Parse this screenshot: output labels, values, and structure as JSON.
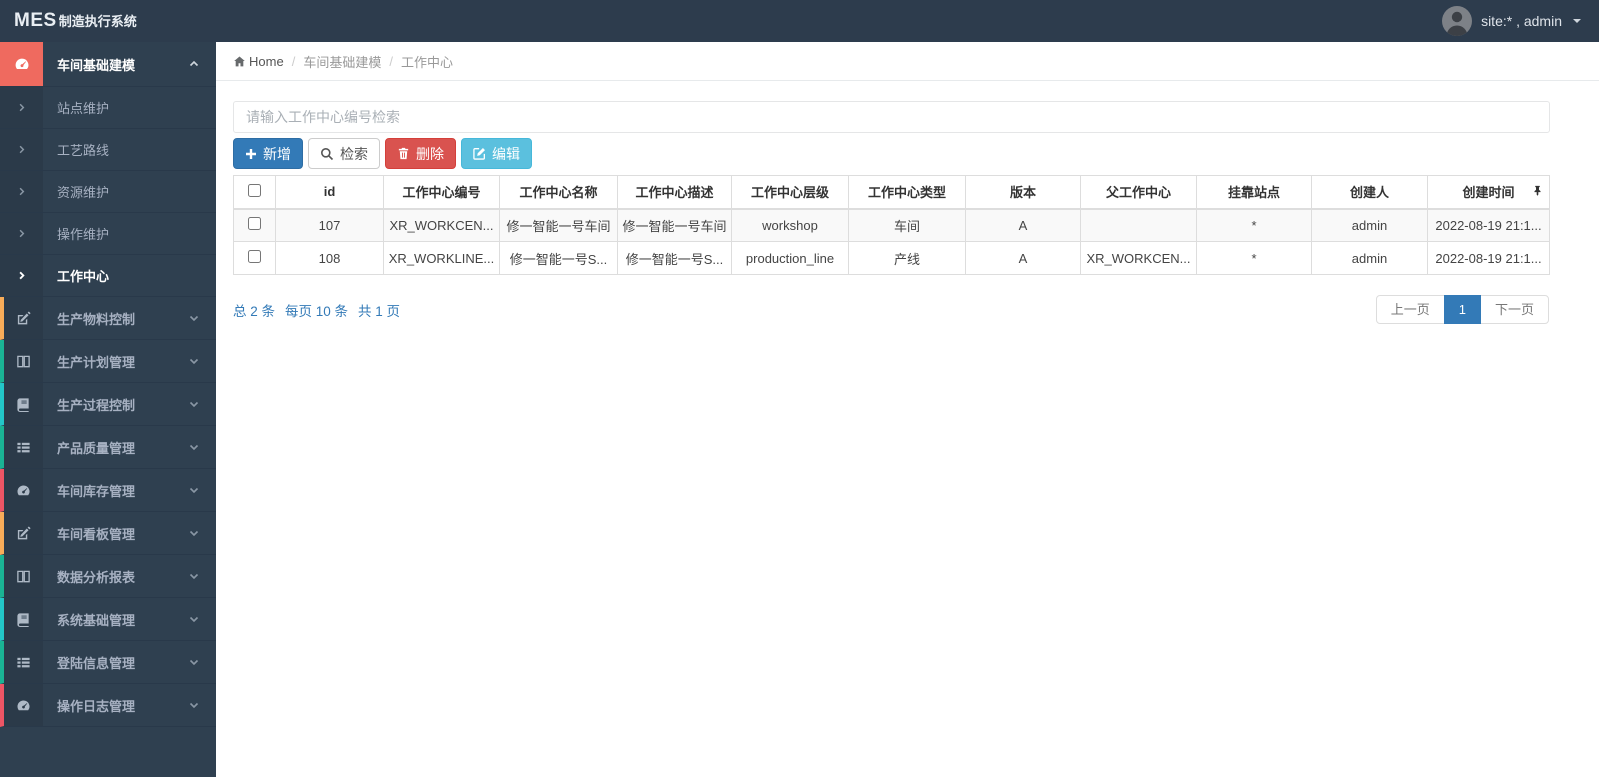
{
  "navbar": {
    "brand_bold": "MES",
    "brand_rest": "制造执行系统",
    "user": "site:* , admin"
  },
  "breadcrumb": {
    "items": [
      "Home",
      "车间基础建模",
      "工作中心"
    ]
  },
  "sidebar": {
    "parent": {
      "label": "车间基础建模"
    },
    "submenu": [
      {
        "label": "站点维护"
      },
      {
        "label": "工艺路线"
      },
      {
        "label": "资源维护"
      },
      {
        "label": "操作维护"
      },
      {
        "label": "工作中心"
      }
    ],
    "active_submenu": "工作中心",
    "items": [
      {
        "label": "生产物料控制",
        "icon": "edit-icon",
        "accent": "#f8ac59"
      },
      {
        "label": "生产计划管理",
        "icon": "columns-icon",
        "accent": "#1ab394"
      },
      {
        "label": "生产过程控制",
        "icon": "book-icon",
        "accent": "#23c6c8"
      },
      {
        "label": "产品质量管理",
        "icon": "list-icon",
        "accent": "#1ab394"
      },
      {
        "label": "车间库存管理",
        "icon": "dashboard-icon",
        "accent": "#ed5565"
      },
      {
        "label": "车间看板管理",
        "icon": "edit-icon",
        "accent": "#f8ac59"
      },
      {
        "label": "数据分析报表",
        "icon": "columns-icon",
        "accent": "#1ab394"
      },
      {
        "label": "系统基础管理",
        "icon": "book-icon",
        "accent": "#23c6c8"
      },
      {
        "label": "登陆信息管理",
        "icon": "list-icon",
        "accent": "#1ab394"
      },
      {
        "label": "操作日志管理",
        "icon": "dashboard-icon",
        "accent": "#ed5565"
      }
    ]
  },
  "search": {
    "placeholder": "请输入工作中心编号检索",
    "value": ""
  },
  "toolbar": {
    "add": "新增",
    "search": "检索",
    "delete": "删除",
    "edit": "编辑"
  },
  "table": {
    "columns": [
      "id",
      "工作中心编号",
      "工作中心名称",
      "工作中心描述",
      "工作中心层级",
      "工作中心类型",
      "版本",
      "父工作中心",
      "挂靠站点",
      "创建人",
      "创建时间"
    ],
    "rows": [
      [
        "107",
        "XR_WORKCEN...",
        "修一智能一号车间",
        "修一智能一号车间",
        "workshop",
        "车间",
        "A",
        "",
        "*",
        "admin",
        "2022-08-19 21:1..."
      ],
      [
        "108",
        "XR_WORKLINE...",
        "修一智能一号S...",
        "修一智能一号S...",
        "production_line",
        "产线",
        "A",
        "XR_WORKCEN...",
        "*",
        "admin",
        "2022-08-19 21:1..."
      ]
    ]
  },
  "pagination": {
    "total": "总 2 条",
    "per_page": "每页 10 条",
    "pages": "共 1 页",
    "prev": "上一页",
    "page": "1",
    "next": "下一页"
  },
  "colors": {
    "navbar-bg": "#2d3c4d",
    "sidebar-bg": "#2f4050",
    "sidebar-icon-col": "#2b3a49",
    "active-icon-bg": "#ef6a5f",
    "primary": "#337ab7",
    "danger": "#d9534f",
    "info": "#5bc0de",
    "link": "#337ab7",
    "border": "#dddddd"
  }
}
